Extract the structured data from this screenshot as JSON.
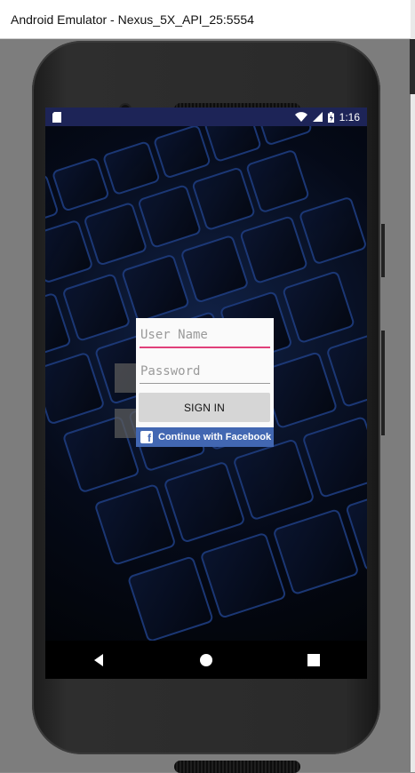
{
  "window": {
    "title": "Android Emulator - Nexus_5X_API_25:5554"
  },
  "statusbar": {
    "time": "1:16",
    "icons": [
      "sd-card-icon",
      "wifi-icon",
      "signal-icon",
      "battery-icon"
    ]
  },
  "login": {
    "username_placeholder": "User Name",
    "password_placeholder": "Password",
    "signin_label": "SIGN IN",
    "facebook_label": "Continue with Facebook"
  },
  "navbar": {
    "buttons": [
      "back-icon",
      "home-icon",
      "recents-icon"
    ]
  },
  "colors": {
    "statusbar": "#1d2457",
    "facebook": "#4267b2",
    "input_focus": "#e0407a"
  }
}
